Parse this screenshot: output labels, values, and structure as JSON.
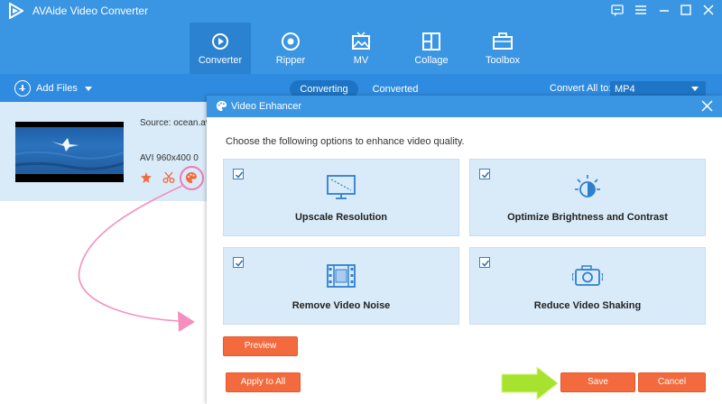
{
  "app": {
    "title": "AVAide Video Converter"
  },
  "nav": {
    "items": [
      {
        "label": "Converter",
        "icon": "converter-icon"
      },
      {
        "label": "Ripper",
        "icon": "ripper-icon"
      },
      {
        "label": "MV",
        "icon": "mv-icon"
      },
      {
        "label": "Collage",
        "icon": "collage-icon"
      },
      {
        "label": "Toolbox",
        "icon": "toolbox-icon"
      }
    ],
    "active": "Converter"
  },
  "toolbar": {
    "add_files": "Add Files",
    "tabs": [
      "Converting",
      "Converted"
    ],
    "active_tab": "Converting",
    "convert_all_label": "Convert All to:",
    "convert_all_value": "MP4"
  },
  "file": {
    "source": "Source: ocean.avi",
    "meta": "AVI   960x400   0"
  },
  "dialog": {
    "title": "Video Enhancer",
    "description": "Choose the following options to enhance video quality.",
    "options": [
      {
        "label": "Upscale Resolution",
        "checked": true,
        "icon": "monitor-icon"
      },
      {
        "label": "Optimize Brightness and Contrast",
        "checked": true,
        "icon": "brightness-icon"
      },
      {
        "label": "Remove Video Noise",
        "checked": true,
        "icon": "film-icon"
      },
      {
        "label": "Reduce Video Shaking",
        "checked": true,
        "icon": "camera-stabilize-icon"
      }
    ],
    "preview_label": "Preview",
    "apply_all_label": "Apply to All",
    "save_label": "Save",
    "cancel_label": "Cancel"
  },
  "colors": {
    "brand_blue": "#3a96e3",
    "accent_orange": "#f26a3d",
    "annotation_pink": "#f07bb0",
    "annotation_green": "#a6e22e"
  }
}
